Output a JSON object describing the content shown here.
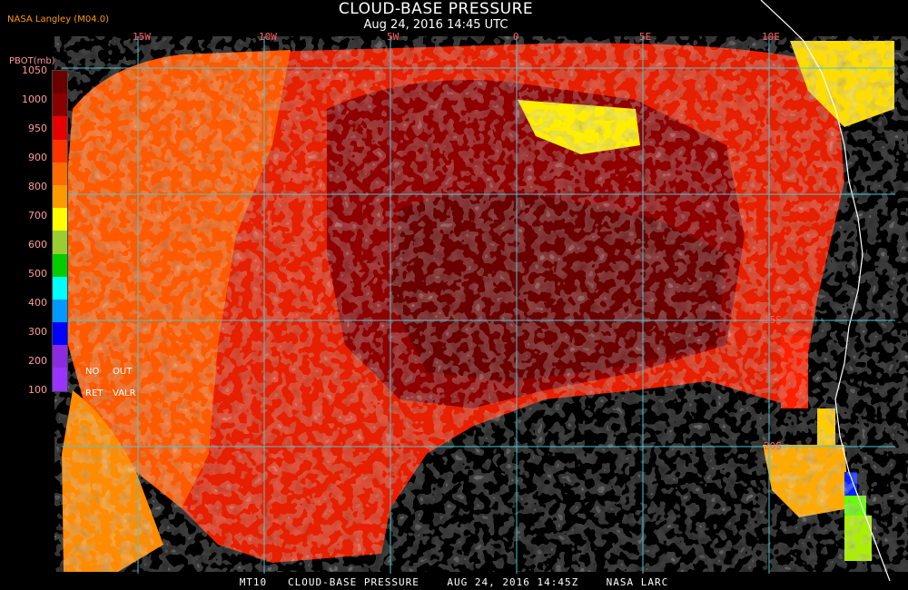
{
  "header": {
    "title": "CLOUD-BASE PRESSURE",
    "subtitle": "Aug 24, 2016 14:45 UTC",
    "agency": "NASA Langley (M04.0)"
  },
  "legend": {
    "unit": "PBOT(mb)",
    "levels": [
      "1050",
      "1000",
      "950",
      "900",
      "800",
      "700",
      "600",
      "500",
      "400",
      "300",
      "200",
      "100"
    ],
    "colors": [
      "#6b0000",
      "#8b0000",
      "#e60000",
      "#ff3300",
      "#ff6a00",
      "#ff9900",
      "#ffff00",
      "#9acd32",
      "#00cc00",
      "#00ffff",
      "#0099ff",
      "#0000ff",
      "#8a2be2",
      "#9933ff"
    ],
    "note_no": "NO",
    "note_out": "OUT",
    "note_ret": "RET",
    "note_valr": "VALR"
  },
  "map": {
    "longitude_labels": [
      "15W",
      "10W",
      "5W",
      "0",
      "5E",
      "10E"
    ],
    "latitude_labels": [
      "15S",
      "20S"
    ],
    "grid_color": "#49c6d6"
  },
  "footer": {
    "text": "MT10   CLOUD-BASE PRESSURE    AUG 24, 2016 14:45Z    NASA LARC"
  }
}
